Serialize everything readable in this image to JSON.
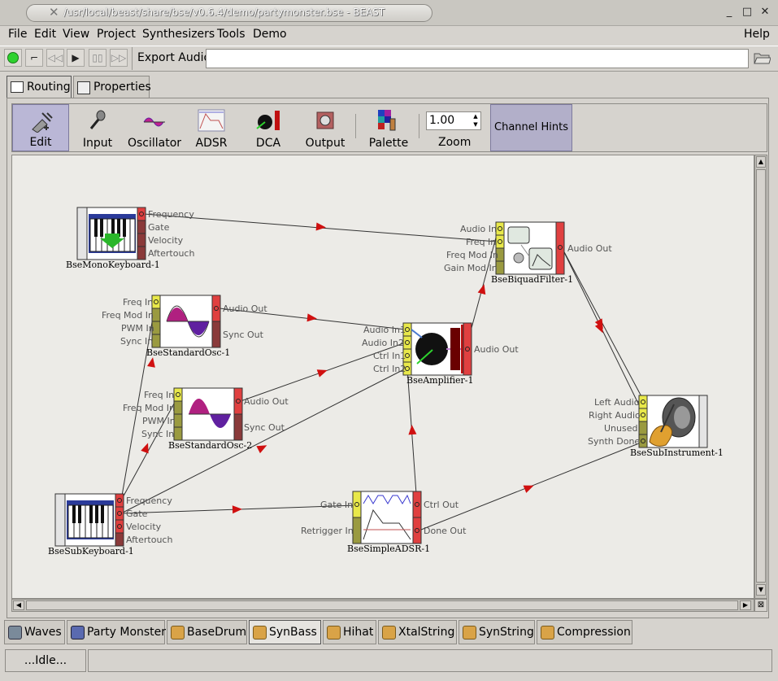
{
  "window": {
    "title": "/usr/local/beast/share/bse/v0.6.4/demo/partymonster.bse - BEAST",
    "controls": [
      "minimize-icon",
      "maximize-icon",
      "close-icon"
    ]
  },
  "menubar": {
    "left": [
      "File",
      "Edit",
      "View",
      "Project",
      "Synthesizers",
      "Tools",
      "Demo"
    ],
    "help": "Help"
  },
  "playbar": {
    "export_label": "Export Audio",
    "export_value": ""
  },
  "notebook": {
    "tabs": [
      "Routing",
      "Properties"
    ],
    "active": "Routing"
  },
  "palette": {
    "tools": [
      "Edit",
      "Input",
      "Oscillator",
      "ADSR",
      "DCA",
      "Output",
      "Palette"
    ],
    "zoom_label": "Zoom",
    "zoom_value": "1.00",
    "channel_hints": "Channel Hints"
  },
  "modules": {
    "mono_keyboard": {
      "name": "BseMonoKeyboard-1",
      "outputs": [
        "Frequency",
        "Gate",
        "Velocity",
        "Aftertouch"
      ]
    },
    "osc1": {
      "name": "BseStandardOsc-1",
      "inputs": [
        "Freq In",
        "Freq Mod In",
        "PWM In",
        "Sync In"
      ],
      "outputs": [
        "Audio Out",
        "Sync Out"
      ]
    },
    "osc2": {
      "name": "BseStandardOsc-2",
      "inputs": [
        "Freq In",
        "Freq Mod In",
        "PWM In",
        "Sync In"
      ],
      "outputs": [
        "Audio Out",
        "Sync Out"
      ]
    },
    "amplifier": {
      "name": "BseAmplifier-1",
      "inputs": [
        "Audio In1",
        "Audio In2",
        "Ctrl In1",
        "Ctrl In2"
      ],
      "outputs": [
        "Audio Out"
      ]
    },
    "filter": {
      "name": "BseBiquadFilter-1",
      "inputs": [
        "Audio In",
        "Freq In",
        "Freq Mod In",
        "Gain Mod In"
      ],
      "outputs": [
        "Audio Out"
      ]
    },
    "sub_instrument": {
      "name": "BseSubInstrument-1",
      "inputs": [
        "Left Audio",
        "Right Audio",
        "Unused",
        "Synth Done"
      ]
    },
    "sub_keyboard": {
      "name": "BseSubKeyboard-1",
      "outputs": [
        "Frequency",
        "Gate",
        "Velocity",
        "Aftertouch"
      ]
    },
    "adsr": {
      "name": "BseSimpleADSR-1",
      "inputs": [
        "Gate In",
        "Retrigger In"
      ],
      "outputs": [
        "Ctrl Out",
        "Done Out"
      ]
    }
  },
  "network_tabs": [
    "Waves",
    "Party Monster",
    "BaseDrum",
    "SynBass",
    "Hihat",
    "XtalString",
    "SynString",
    "Compression"
  ],
  "active_network_tab": "SynBass",
  "status": "...Idle...",
  "colors": {
    "port_in": "#e8e84a",
    "port_out": "#e04040",
    "port_in_dark": "#9a9a40",
    "port_out_dark": "#8a3a3a",
    "arrow": "#d01010"
  }
}
